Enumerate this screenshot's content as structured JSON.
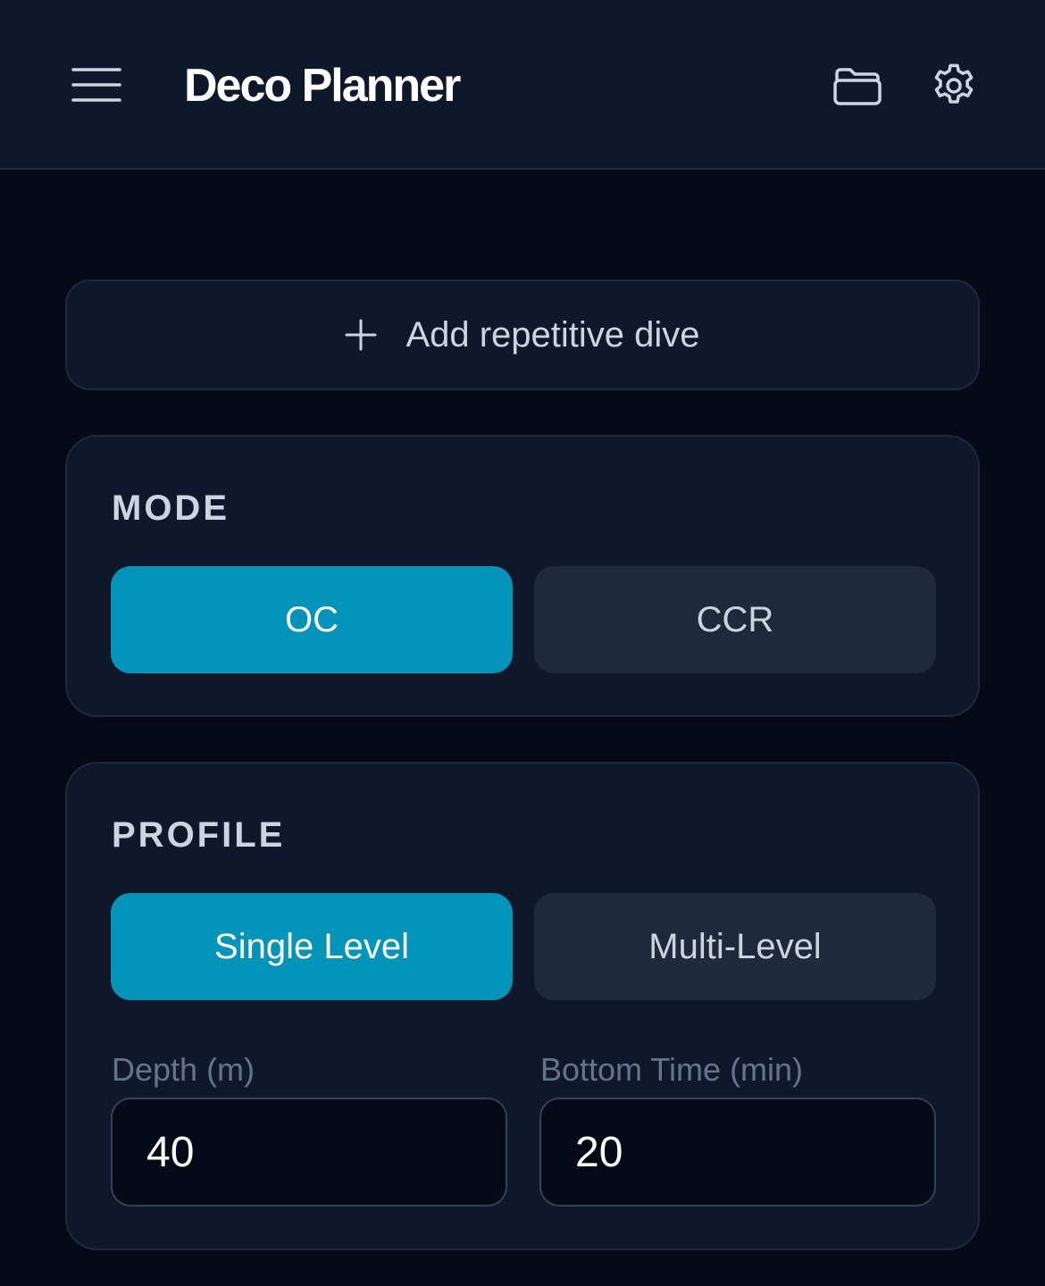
{
  "header": {
    "title": "Deco Planner",
    "icons": {
      "menu": "hamburger-menu-icon",
      "open": "folder-open-icon",
      "settings": "gear-icon"
    }
  },
  "add_dive": {
    "icon": "plus-icon",
    "label": "Add repetitive dive"
  },
  "mode": {
    "label": "MODE",
    "options": [
      "OC",
      "CCR"
    ],
    "selected": "OC"
  },
  "profile": {
    "label": "PROFILE",
    "options": [
      "Single Level",
      "Multi-Level"
    ],
    "selected": "Single Level",
    "depth": {
      "label": "Depth (m)",
      "value": "40"
    },
    "bottom_time": {
      "label": "Bottom Time (min)",
      "value": "20"
    }
  },
  "colors": {
    "background": "#050a17",
    "surface": "#0f172a",
    "border": "#1e293b",
    "accent": "#0293b8",
    "text": "#ffffff",
    "muted_text": "#cbd5e1",
    "label_text": "#64748b"
  }
}
